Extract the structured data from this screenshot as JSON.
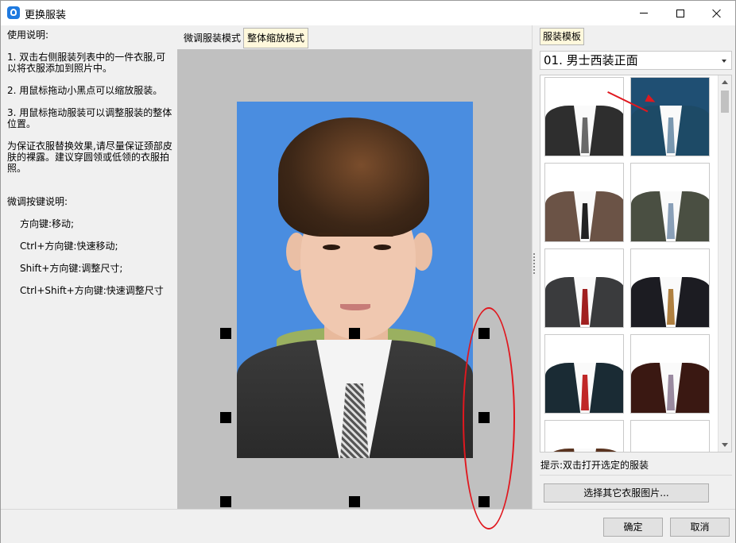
{
  "window": {
    "title": "更换服装"
  },
  "help": {
    "heading": "使用说明:",
    "step1": "1. 双击右侧服装列表中的一件衣服,可以将衣服添加到照片中。",
    "step2": "2. 用鼠标拖动小黑点可以缩放服装。",
    "step3": "3. 用鼠标拖动服装可以调整服装的整体位置。",
    "tip": "为保证衣服替换效果,请尽量保证颈部皮肤的裸露。建议穿圆领或低领的衣服拍照。",
    "keys_heading": "微调按键说明:",
    "keys": [
      "方向键:移动;",
      "Ctrl+方向键:快速移动;",
      "Shift+方向键:调整尺寸;",
      "Ctrl+Shift+方向键:快速调整尺寸"
    ]
  },
  "center_tabs": [
    "微调服装模式",
    "整体缩放模式"
  ],
  "active_center_tab": "整体缩放模式",
  "right_panel": {
    "tab": "服装模板",
    "dropdown_value": "01. 男士西装正面",
    "hint": "提示:双击打开选定的服装",
    "select_button": "选择其它衣服图片..."
  },
  "thumbnails": [
    {
      "suit": "#2e2e2e",
      "tie": "#6a6a6a"
    },
    {
      "suit": "#1d4a66",
      "tie": "#7a98b0"
    },
    {
      "suit": "#6b5346",
      "tie": "#222222"
    },
    {
      "suit": "#4a4f42",
      "tie": "#8aa0b8"
    },
    {
      "suit": "#3a3b3d",
      "tie": "#a02020"
    },
    {
      "suit": "#1c1c22",
      "tie": "#b08040"
    },
    {
      "suit": "#1a2b34",
      "tie": "#c02828"
    },
    {
      "suit": "#3a1812",
      "tie": "#9a8aa0"
    },
    {
      "suit": "#5a3420",
      "tie": "#f4f4f4"
    },
    {
      "suit": "#ffffff",
      "tie": "#ffffff"
    }
  ],
  "accent": {
    "annotation": "#e0181f",
    "photo_bg": "#4a8de0",
    "active_tab": "#fff8dc"
  },
  "footer": {
    "ok": "确定",
    "cancel": "取消"
  }
}
